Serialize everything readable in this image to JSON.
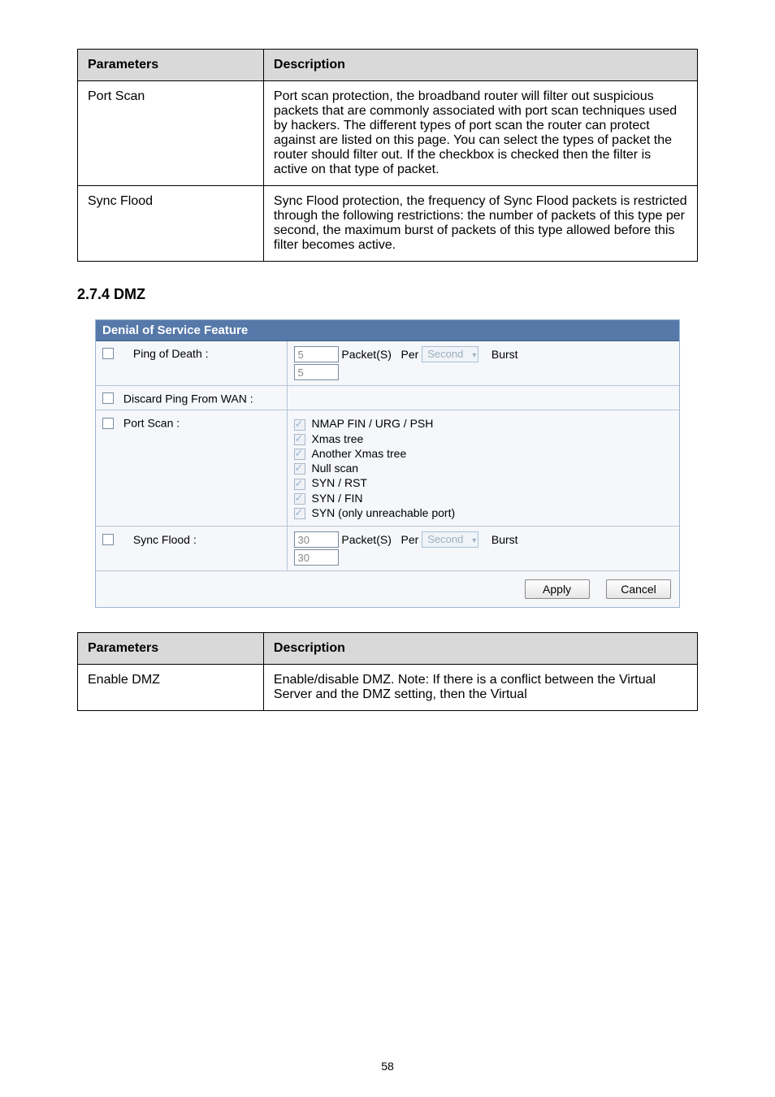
{
  "table1": {
    "headers": [
      "Parameters",
      "Description"
    ],
    "rows": [
      {
        "param": "Port Scan",
        "desc": "Port scan protection, the broadband router will filter out suspicious packets that are commonly associated with port scan techniques used by hackers. The different types of port scan the router can protect against are listed on this page. You can select the types of packet the router should filter out. If the checkbox is checked then the filter is active on that type of packet."
      },
      {
        "param": "Sync Flood",
        "desc": "Sync Flood protection, the frequency of Sync Flood packets is restricted through the following restrictions: the number of packets of this type per second, the maximum burst of packets of this type allowed before this filter becomes active."
      }
    ]
  },
  "heading": "2.7.4 DMZ",
  "panel": {
    "title": "Denial of Service Feature",
    "ping_of_death": {
      "label": "Ping of Death :",
      "pkt": "5",
      "packets": "Packet(S)",
      "per": "Per",
      "unit": "Second",
      "burst": "Burst",
      "burst_val": "5"
    },
    "discard_ping": {
      "label": "Discard Ping From WAN :"
    },
    "port_scan": {
      "label": "Port Scan :",
      "items": [
        "NMAP FIN / URG / PSH",
        "Xmas tree",
        "Another Xmas tree",
        "Null scan",
        "SYN / RST",
        "SYN / FIN",
        "SYN (only unreachable port)"
      ]
    },
    "sync_flood": {
      "label": "Sync Flood :",
      "pkt": "30",
      "packets": "Packet(S)",
      "per": "Per",
      "unit": "Second",
      "burst": "Burst",
      "burst_val": "30"
    },
    "apply": "Apply",
    "cancel": "Cancel"
  },
  "table2": {
    "headers": [
      "Parameters",
      "Description"
    ],
    "rows": [
      {
        "param": "Enable DMZ",
        "desc": "Enable/disable DMZ. Note: If there is a conflict between the Virtual Server and the DMZ setting, then the Virtual"
      }
    ]
  },
  "pagenum": "58"
}
